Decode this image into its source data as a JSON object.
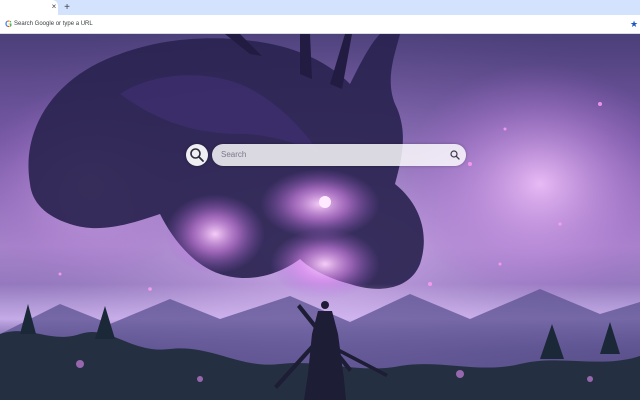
{
  "browser": {
    "tab": {
      "title": "",
      "close_glyph": "×"
    },
    "new_tab_glyph": "+",
    "omnibox": {
      "provider_icon": "G",
      "placeholder": "Search Google or type a URL",
      "bookmark_icon": "star-icon"
    }
  },
  "new_tab_page": {
    "wallpaper": "dragon-and-samurai-artwork",
    "search": {
      "placeholder": "Search",
      "icon": "search-icon"
    }
  },
  "colors": {
    "tabstrip": "#d3e3fd",
    "toolbar": "#ffffff",
    "bookmark_star": "#1a56c4",
    "google_blue": "#4285f4",
    "google_red": "#ea4335",
    "google_yellow": "#fbbc05",
    "google_green": "#34a853",
    "wallpaper_glow": "#e7a9ff"
  }
}
